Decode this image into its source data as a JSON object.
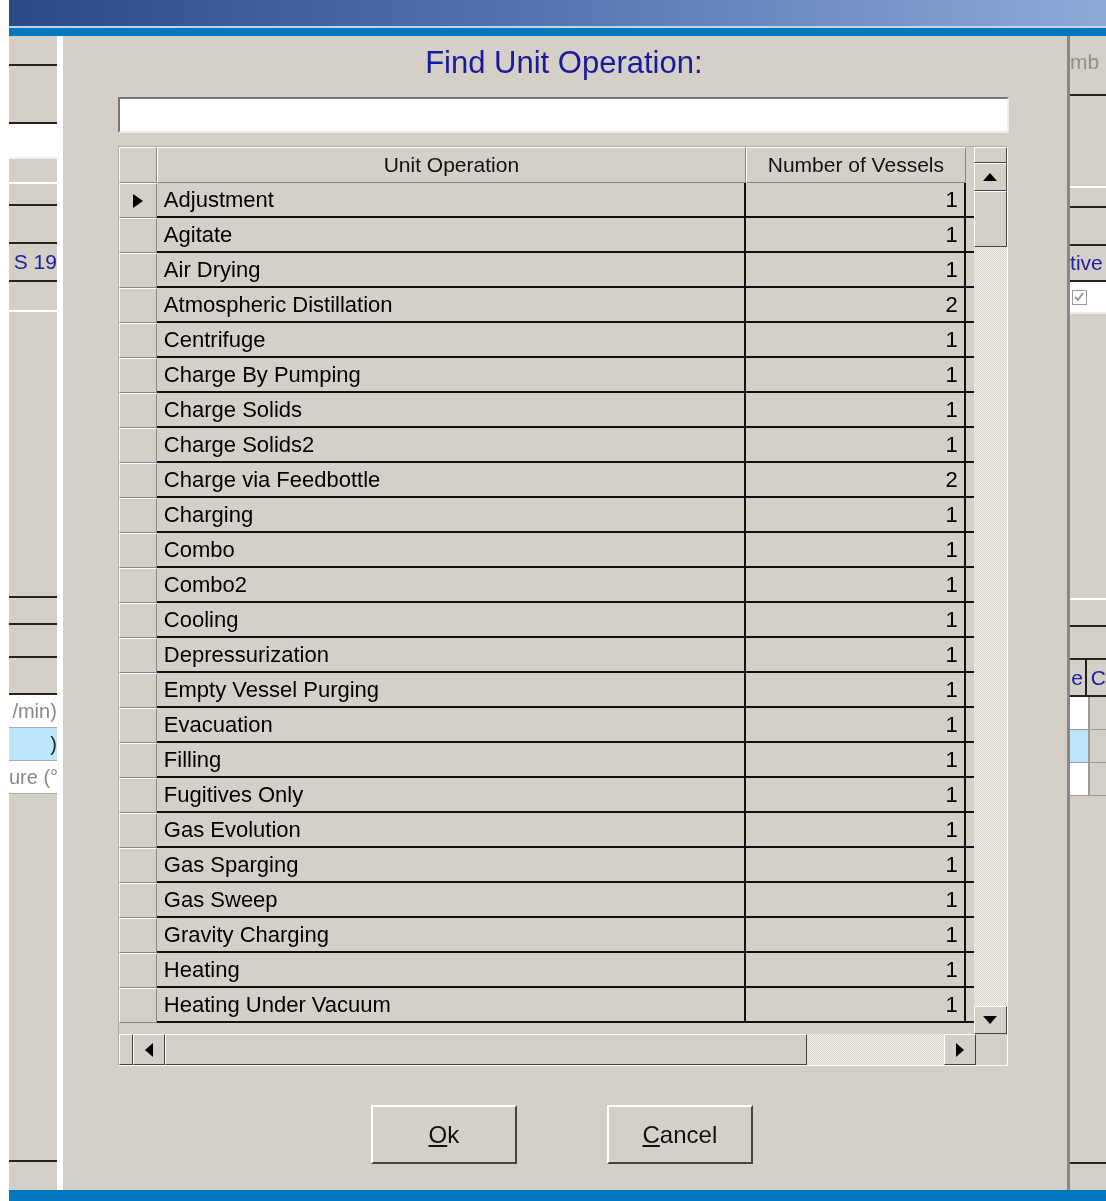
{
  "background_left": {
    "label": "S 19",
    "rows": [
      {
        "text": "/min)",
        "selected": false
      },
      {
        "text": ")",
        "selected": true
      },
      {
        "text": "ure (°",
        "selected": false
      }
    ]
  },
  "background_right": {
    "label": "mb",
    "column_label": "tive",
    "checkbox": {
      "checked": true
    },
    "headers": [
      "e",
      "C"
    ],
    "rows": [
      {
        "selected": false
      },
      {
        "selected": true
      },
      {
        "selected": false
      }
    ]
  },
  "dialog": {
    "title": "Find Unit Operation:",
    "table": {
      "columns": [
        "Unit Operation",
        "Number of Vessels"
      ],
      "rows": [
        {
          "name": "Adjustment",
          "vessels": "1",
          "selected": true
        },
        {
          "name": "Agitate",
          "vessels": "1",
          "selected": false
        },
        {
          "name": "Air Drying",
          "vessels": "1",
          "selected": false
        },
        {
          "name": "Atmospheric Distillation",
          "vessels": "2",
          "selected": false
        },
        {
          "name": "Centrifuge",
          "vessels": "1",
          "selected": false
        },
        {
          "name": "Charge By Pumping",
          "vessels": "1",
          "selected": false
        },
        {
          "name": "Charge Solids",
          "vessels": "1",
          "selected": false
        },
        {
          "name": "Charge Solids2",
          "vessels": "1",
          "selected": false
        },
        {
          "name": "Charge via Feedbottle",
          "vessels": "2",
          "selected": false
        },
        {
          "name": "Charging",
          "vessels": "1",
          "selected": false
        },
        {
          "name": "Combo",
          "vessels": "1",
          "selected": false
        },
        {
          "name": "Combo2",
          "vessels": "1",
          "selected": false
        },
        {
          "name": "Cooling",
          "vessels": "1",
          "selected": false
        },
        {
          "name": "Depressurization",
          "vessels": "1",
          "selected": false
        },
        {
          "name": "Empty Vessel Purging",
          "vessels": "1",
          "selected": false
        },
        {
          "name": "Evacuation",
          "vessels": "1",
          "selected": false
        },
        {
          "name": "Filling",
          "vessels": "1",
          "selected": false
        },
        {
          "name": "Fugitives Only",
          "vessels": "1",
          "selected": false
        },
        {
          "name": "Gas Evolution",
          "vessels": "1",
          "selected": false
        },
        {
          "name": "Gas Sparging",
          "vessels": "1",
          "selected": false
        },
        {
          "name": "Gas Sweep",
          "vessels": "1",
          "selected": false
        },
        {
          "name": "Gravity Charging",
          "vessels": "1",
          "selected": false
        },
        {
          "name": "Heating",
          "vessels": "1",
          "selected": false
        },
        {
          "name": "Heating Under Vacuum",
          "vessels": "1",
          "selected": false
        }
      ]
    },
    "buttons": [
      {
        "label": "Ok"
      },
      {
        "label": "Cancel"
      }
    ]
  }
}
